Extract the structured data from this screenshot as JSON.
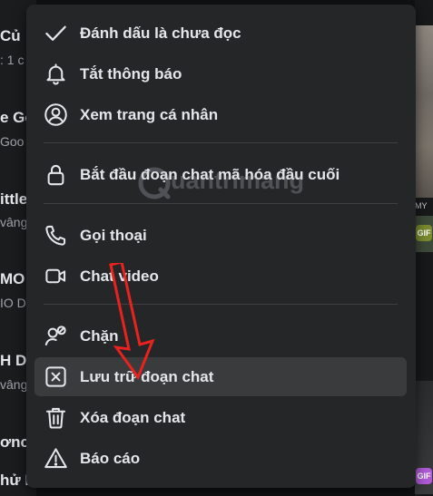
{
  "background": {
    "left_fragments": [
      {
        "text": "Củ",
        "kind": "title"
      },
      {
        "text": ": 1 c",
        "kind": "sub"
      },
      {
        "text": "e Go",
        "kind": "title"
      },
      {
        "text": "Goo",
        "kind": "sub"
      },
      {
        "text": "ittle",
        "kind": "title"
      },
      {
        "text": "vâng",
        "kind": "sub"
      },
      {
        "text": "MO",
        "kind": "title"
      },
      {
        "text": "IO D",
        "kind": "sub"
      },
      {
        "text": "H D",
        "kind": "title"
      },
      {
        "text": "vâng",
        "kind": "sub"
      },
      {
        "text": "ơnc",
        "kind": "title"
      },
      {
        "text": "hử M",
        "kind": "title"
      }
    ],
    "right_fragments": [
      {
        "text": "MY"
      },
      {
        "text": "GIF"
      },
      {
        "text": "GIF"
      }
    ]
  },
  "menu": {
    "items": [
      {
        "label": "Đánh dấu là chưa đọc",
        "icon": "checkmark-icon"
      },
      {
        "label": "Tắt thông báo",
        "icon": "bell-icon"
      },
      {
        "label": "Xem trang cá nhân",
        "icon": "user-circle-icon"
      },
      {
        "label": "Bắt đầu đoạn chat mã hóa đầu cuối",
        "icon": "lock-icon"
      },
      {
        "label": "Gọi thoại",
        "icon": "phone-icon"
      },
      {
        "label": "Chat video",
        "icon": "video-camera-icon"
      },
      {
        "label": "Chặn",
        "icon": "block-user-icon"
      },
      {
        "label": "Lưu trữ đoạn chat",
        "icon": "archive-box-icon"
      },
      {
        "label": "Xóa đoạn chat",
        "icon": "trash-icon"
      },
      {
        "label": "Báo cáo",
        "icon": "warning-icon"
      }
    ],
    "highlighted_item": "Lưu trữ đoạn chat"
  },
  "watermark": {
    "text": "uantrimang"
  },
  "colors": {
    "menu_bg": "#252627",
    "hover_bg": "#3a3b3c",
    "text": "#e4e6eb",
    "annotation_red": "#e8231f",
    "page_bg": "#111213"
  }
}
